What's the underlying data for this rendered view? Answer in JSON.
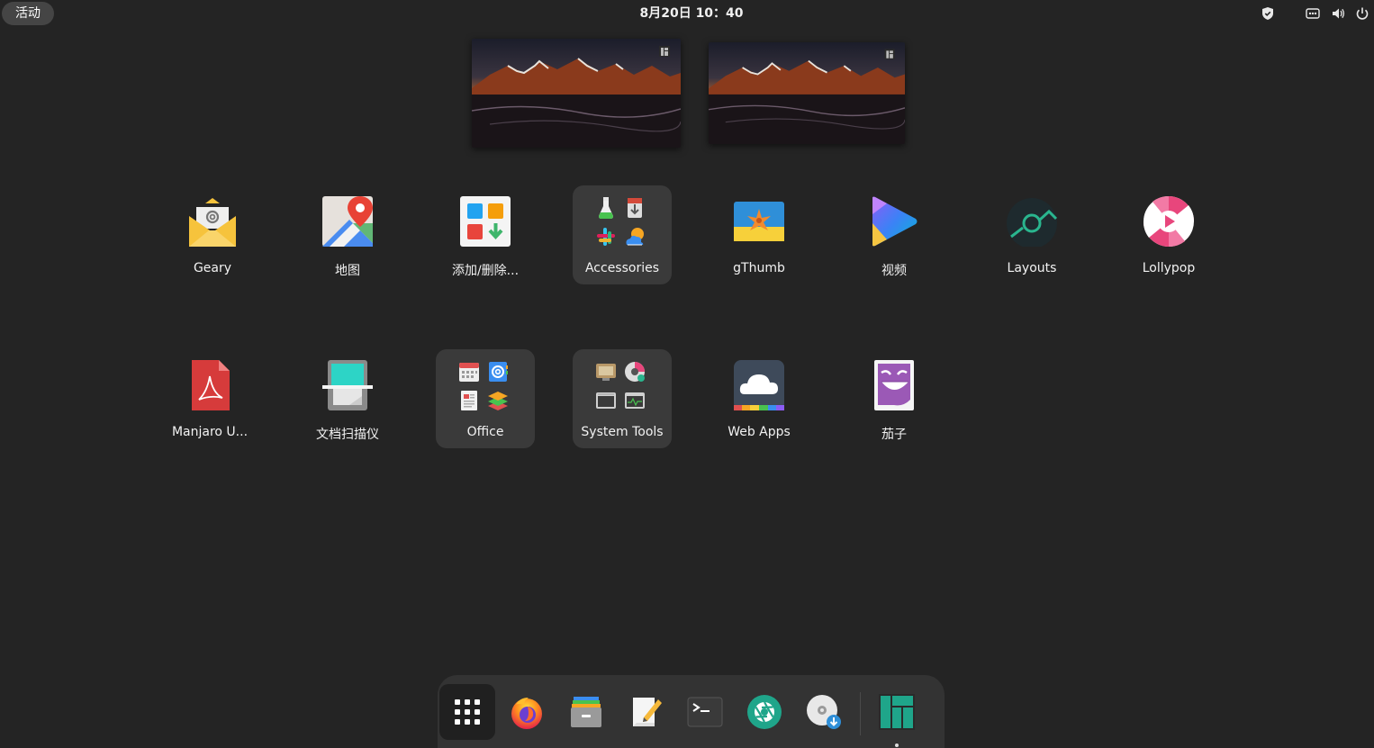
{
  "topbar": {
    "activities": "活动",
    "clock": "8月20日  10：40"
  },
  "tray": [
    "shield-icon",
    "network-icon",
    "volume-icon",
    "power-icon"
  ],
  "apps_row1": [
    {
      "label": "Geary",
      "icon": "geary-mail-icon"
    },
    {
      "label": "地图",
      "icon": "maps-icon"
    },
    {
      "label": "添加/删除...",
      "icon": "add-remove-software-icon"
    },
    {
      "label": "Accessories",
      "icon": "accessories-folder",
      "folder": true
    },
    {
      "label": "gThumb",
      "icon": "gthumb-icon"
    },
    {
      "label": "视频",
      "icon": "videos-icon"
    },
    {
      "label": "Layouts",
      "icon": "layouts-icon"
    },
    {
      "label": "Lollypop",
      "icon": "lollypop-icon"
    }
  ],
  "apps_row2": [
    {
      "label": "Manjaro U...",
      "icon": "pdf-document-icon"
    },
    {
      "label": "文档扫描仪",
      "icon": "document-scanner-icon"
    },
    {
      "label": "Office",
      "icon": "office-folder",
      "folder": true
    },
    {
      "label": "System Tools",
      "icon": "system-tools-folder",
      "folder": true
    },
    {
      "label": "Web Apps",
      "icon": "web-apps-cloud-icon"
    },
    {
      "label": "茄子",
      "icon": "cheese-icon"
    }
  ],
  "dock": [
    "show-apps-grid-icon",
    "firefox-icon",
    "file-manager-icon",
    "text-editor-icon",
    "terminal-icon",
    "camera-aperture-icon",
    "disc-download-icon",
    "manjaro-logo-icon"
  ],
  "colors": {
    "background": "#242424",
    "folder_tile": "#3a3a3a",
    "dock": "#333333",
    "manjaro_green": "#35bf5c"
  }
}
